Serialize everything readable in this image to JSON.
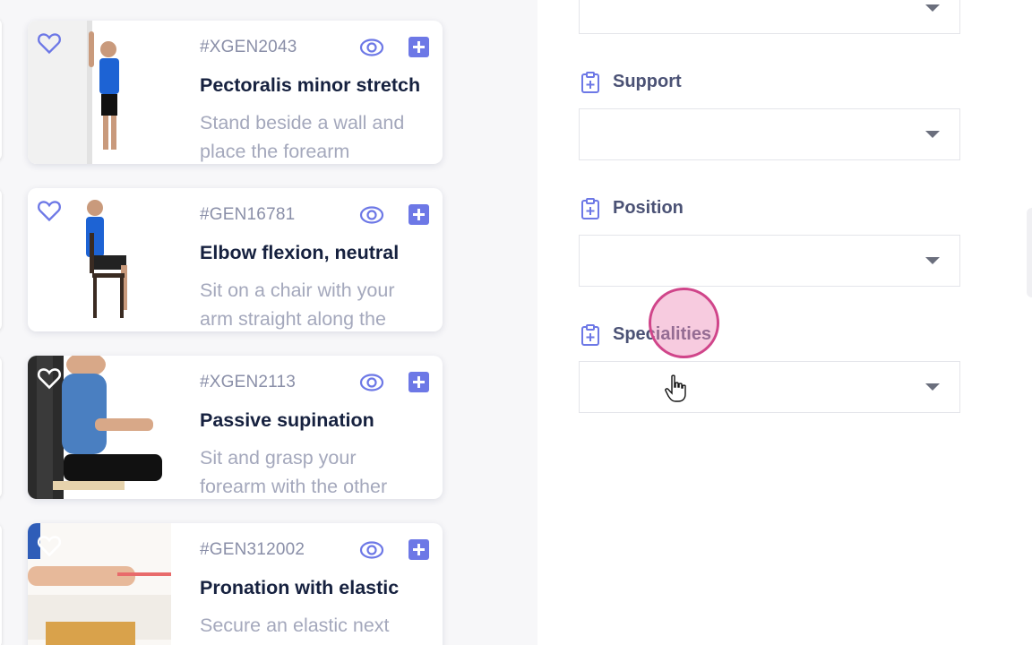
{
  "exercises": [
    {
      "code": "#XGEN2043",
      "title": "Pectoralis minor stretch",
      "description": "Stand beside a wall and\nplace the forearm"
    },
    {
      "code": "#GEN16781",
      "title": "Elbow flexion, neutral",
      "description": "Sit on a chair with your\narm straight along the"
    },
    {
      "code": "#XGEN2113",
      "title": "Passive supination",
      "description": "Sit and grasp your\nforearm with the other"
    },
    {
      "code": "#GEN312002",
      "title": "Pronation with elastic",
      "description": "Secure an elastic next"
    }
  ],
  "filters": {
    "support": {
      "label": "Support",
      "value": ""
    },
    "position": {
      "label": "Position",
      "value": ""
    },
    "specialities": {
      "label": "Specialities",
      "value": ""
    }
  },
  "icons": {
    "favorite": "heart-outline-icon",
    "preview": "eye-icon",
    "add": "plus-square-icon",
    "filter_category": "clipboard-plus-icon",
    "dropdown": "caret-down-icon"
  },
  "colors": {
    "accent": "#6d78e6",
    "title_text": "#16213f",
    "muted_text": "#a4a8bc",
    "click_highlight": "#d0458a"
  }
}
